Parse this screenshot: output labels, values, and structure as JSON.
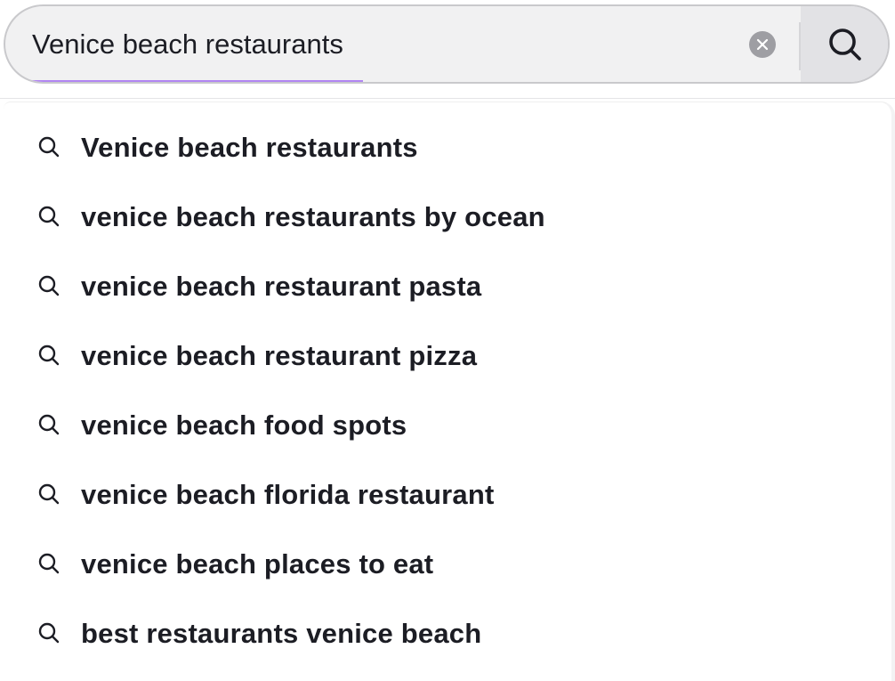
{
  "search": {
    "query": "Venice beach restaurants",
    "accent_color": "#b185f2",
    "clear_icon": "close-circle-icon",
    "submit_icon": "search-icon"
  },
  "suggestions": [
    {
      "label": "Venice beach restaurants",
      "icon": "search-icon"
    },
    {
      "label": "venice beach restaurants by ocean",
      "icon": "search-icon"
    },
    {
      "label": "venice beach restaurant pasta",
      "icon": "search-icon"
    },
    {
      "label": "venice beach restaurant pizza",
      "icon": "search-icon"
    },
    {
      "label": "venice beach food spots",
      "icon": "search-icon"
    },
    {
      "label": "venice beach florida restaurant",
      "icon": "search-icon"
    },
    {
      "label": "venice beach places to eat",
      "icon": "search-icon"
    },
    {
      "label": "best restaurants venice beach",
      "icon": "search-icon"
    }
  ]
}
